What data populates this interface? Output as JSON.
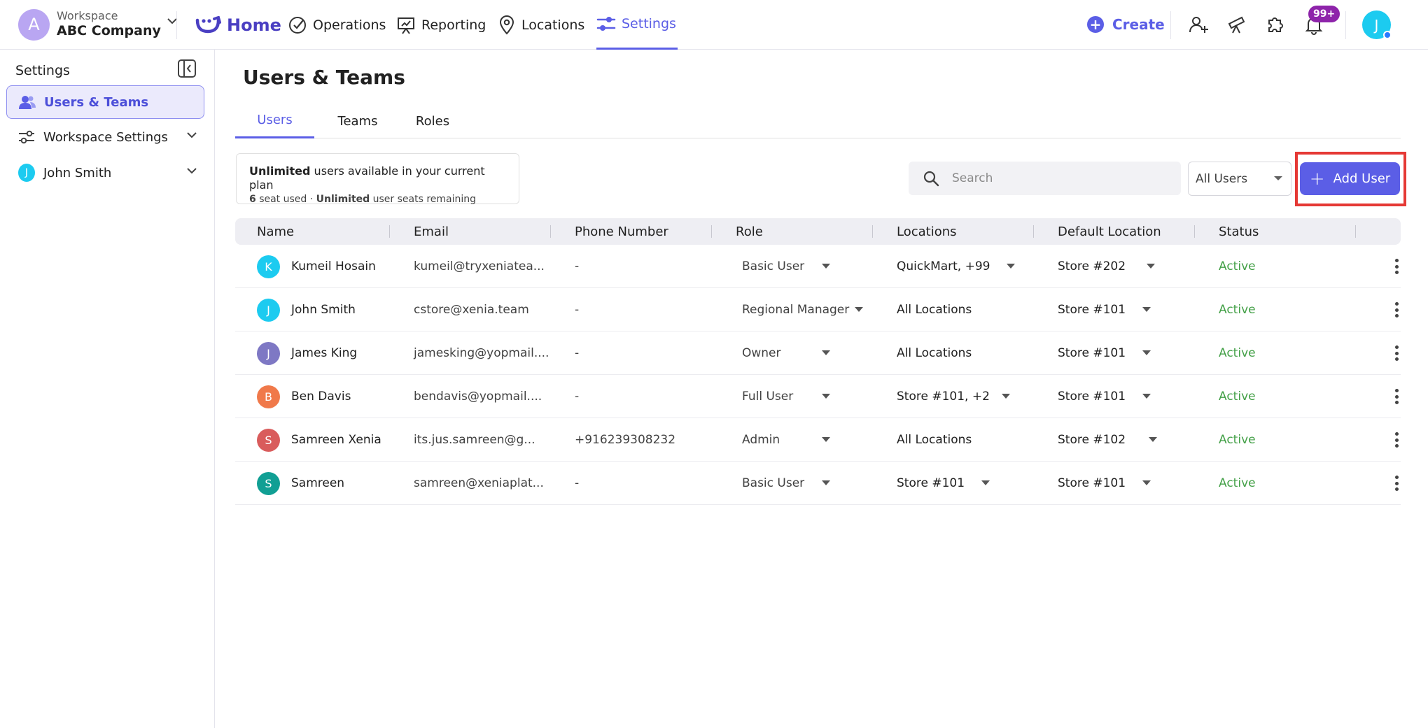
{
  "workspace": {
    "label": "Workspace",
    "name": "ABC Company",
    "initial": "A"
  },
  "nav": {
    "home": "Home",
    "operations": "Operations",
    "reporting": "Reporting",
    "locations": "Locations",
    "settings": "Settings"
  },
  "topbar": {
    "create": "Create",
    "notifications_badge": "99+",
    "user_initial": "J"
  },
  "sidebar": {
    "title": "Settings",
    "items": [
      {
        "label": "Users & Teams"
      },
      {
        "label": "Workspace Settings"
      },
      {
        "label": "John Smith",
        "initial": "J"
      }
    ]
  },
  "page": {
    "title": "Users & Teams"
  },
  "tabs": [
    "Users",
    "Teams",
    "Roles"
  ],
  "plan": {
    "l1_bold": "Unlimited",
    "l1_rest": " users available in your current plan",
    "l2_count": "6",
    "l2_mid": " seat used · ",
    "l2_bold": "Unlimited",
    "l2_rest": " user seats remaining"
  },
  "search": {
    "placeholder": "Search"
  },
  "filter": {
    "selected": "All Users"
  },
  "add_user": {
    "label": "Add User"
  },
  "table": {
    "headers": [
      "Name",
      "Email",
      "Phone Number",
      "Role",
      "Locations",
      "Default Location",
      "Status"
    ],
    "rows": [
      {
        "initial": "K",
        "color": "#1ccbf0",
        "name": "Kumeil Hosain",
        "email": "kumeil@tryxeniatea...",
        "phone": "-",
        "role": "Basic User",
        "locations": "QuickMart, +99",
        "default": "Store #202",
        "status": "Active"
      },
      {
        "initial": "J",
        "color": "#1ccbf0",
        "name": "John Smith",
        "email": "cstore@xenia.team",
        "phone": "-",
        "role": "Regional Manager",
        "locations": "All Locations",
        "default": "Store #101",
        "status": "Active"
      },
      {
        "initial": "J",
        "color": "#7e78c4",
        "name": "James King",
        "email": "jamesking@yopmail....",
        "phone": "-",
        "role": "Owner",
        "locations": "All Locations",
        "default": "Store #101",
        "status": "Active"
      },
      {
        "initial": "B",
        "color": "#f0794a",
        "name": "Ben Davis",
        "email": "bendavis@yopmail....",
        "phone": "-",
        "role": "Full User",
        "locations": "Store #101, +2",
        "default": "Store #101",
        "status": "Active"
      },
      {
        "initial": "S",
        "color": "#d95c5c",
        "name": "Samreen Xenia",
        "email": "its.jus.samreen@g...",
        "phone": "+916239308232",
        "role": "Admin",
        "locations": "All Locations",
        "default": "Store #102",
        "status": "Active"
      },
      {
        "initial": "S",
        "color": "#119f94",
        "name": "Samreen",
        "email": "samreen@xeniaplat...",
        "phone": "-",
        "role": "Basic User",
        "locations": "Store #101",
        "default": "Store #101",
        "status": "Active"
      }
    ]
  }
}
